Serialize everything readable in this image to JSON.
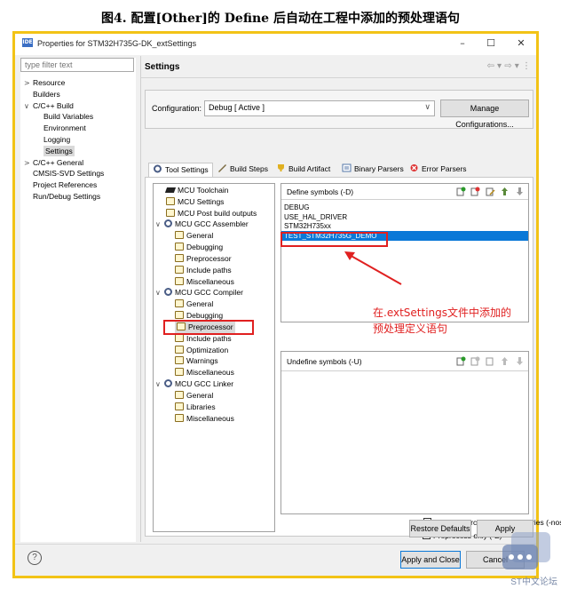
{
  "caption": "图4. 配置[Other]的 Define 后自动在工程中添加的预处理语句",
  "window": {
    "app_icon_text": "IDE",
    "title": "Properties for STM32H735G-DK_extSettings",
    "minimize": "–",
    "maximize": "☐",
    "close": "✕"
  },
  "filter": {
    "placeholder": "type filter text"
  },
  "nav": [
    {
      "label": "Resource",
      "arrow": ">"
    },
    {
      "label": "Builders",
      "arrow": ""
    },
    {
      "label": "C/C++ Build",
      "arrow": "∨"
    },
    {
      "label": "Build Variables",
      "arrow": ""
    },
    {
      "label": "Environment",
      "arrow": ""
    },
    {
      "label": "Logging",
      "arrow": ""
    },
    {
      "label": "Settings",
      "arrow": ""
    },
    {
      "label": "C/C++ General",
      "arrow": ">"
    },
    {
      "label": "CMSIS-SVD Settings",
      "arrow": ""
    },
    {
      "label": "Project References",
      "arrow": ""
    },
    {
      "label": "Run/Debug Settings",
      "arrow": ""
    }
  ],
  "settings": {
    "title": "Settings",
    "nav_arrows": "⇦ ▾ ⇨ ▾ ⋮",
    "config_label": "Configuration:",
    "config_value": "Debug  [ Active ]",
    "config_arrow": "∨",
    "manage_label": "Manage Configurations..."
  },
  "tabs": [
    {
      "label": "Tool Settings",
      "icon": "tool-settings-icon"
    },
    {
      "label": "Build Steps",
      "icon": "build-steps-icon"
    },
    {
      "label": "Build Artifact",
      "icon": "build-artifact-icon"
    },
    {
      "label": "Binary Parsers",
      "icon": "binary-parsers-icon"
    },
    {
      "label": "Error Parsers",
      "icon": "error-parsers-icon"
    }
  ],
  "tree": [
    {
      "label": "MCU Toolchain",
      "icon": "chip-icon",
      "arrow": ""
    },
    {
      "label": "MCU Settings",
      "icon": "settings-page-icon",
      "arrow": ""
    },
    {
      "label": "MCU Post build outputs",
      "icon": "settings-page-icon",
      "arrow": ""
    },
    {
      "label": "MCU GCC Assembler",
      "icon": "gear-icon",
      "arrow": "∨"
    },
    {
      "label": "General",
      "icon": "settings-page-icon",
      "arrow": ""
    },
    {
      "label": "Debugging",
      "icon": "settings-page-icon",
      "arrow": ""
    },
    {
      "label": "Preprocessor",
      "icon": "settings-page-icon",
      "arrow": ""
    },
    {
      "label": "Include paths",
      "icon": "settings-page-icon",
      "arrow": ""
    },
    {
      "label": "Miscellaneous",
      "icon": "settings-page-icon",
      "arrow": ""
    },
    {
      "label": "MCU GCC Compiler",
      "icon": "gear-icon",
      "arrow": "∨"
    },
    {
      "label": "General",
      "icon": "settings-page-icon",
      "arrow": ""
    },
    {
      "label": "Debugging",
      "icon": "settings-page-icon",
      "arrow": ""
    },
    {
      "label": "Preprocessor",
      "icon": "settings-page-icon",
      "arrow": ""
    },
    {
      "label": "Include paths",
      "icon": "settings-page-icon",
      "arrow": ""
    },
    {
      "label": "Optimization",
      "icon": "settings-page-icon",
      "arrow": ""
    },
    {
      "label": "Warnings",
      "icon": "settings-page-icon",
      "arrow": ""
    },
    {
      "label": "Miscellaneous",
      "icon": "settings-page-icon",
      "arrow": ""
    },
    {
      "label": "MCU GCC Linker",
      "icon": "gear-icon",
      "arrow": "∨"
    },
    {
      "label": "General",
      "icon": "settings-page-icon",
      "arrow": ""
    },
    {
      "label": "Libraries",
      "icon": "settings-page-icon",
      "arrow": ""
    },
    {
      "label": "Miscellaneous",
      "icon": "settings-page-icon",
      "arrow": ""
    }
  ],
  "define": {
    "title": "Define symbols (-D)",
    "symbols": [
      "DEBUG",
      "USE_HAL_DRIVER",
      "STM32H735xx",
      "TEST_STM32H735G_DEMO"
    ]
  },
  "undefine": {
    "title": "Undefine symbols (-U)"
  },
  "annotation": {
    "line1": "在.extSettings文件中添加的",
    "line2": "预处理定义语句"
  },
  "checks": {
    "nostdinc": "Do not search system directories (-nostdinc)",
    "preprocess": "Preprocess only (-E)"
  },
  "buttons": {
    "restore": "Restore Defaults",
    "apply": "Apply",
    "apply_close": "Apply and Close",
    "cancel": "Cancel",
    "help": "?"
  },
  "watermark": {
    "text": "ST中文论坛"
  },
  "colors": {
    "selection": "#0a78d7",
    "highlight": "#e02020",
    "frame": "#f2c316"
  }
}
